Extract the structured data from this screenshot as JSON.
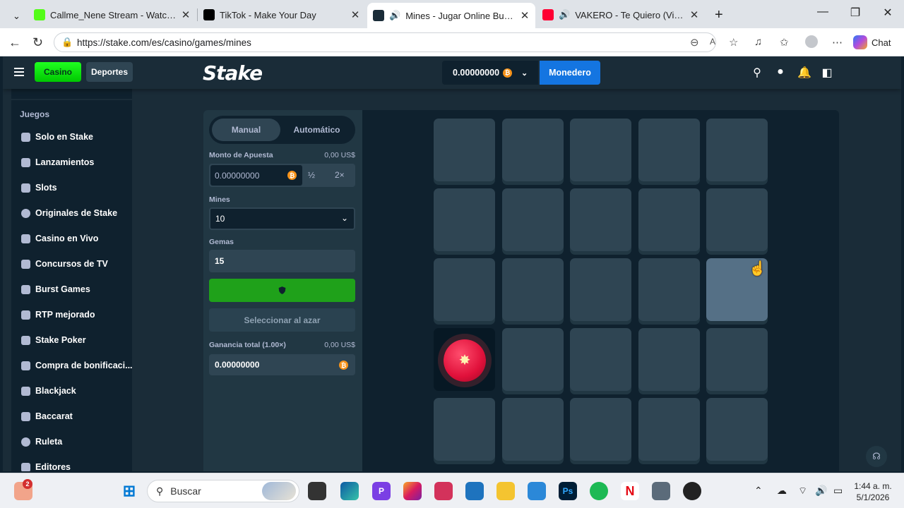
{
  "browser": {
    "tabs": [
      {
        "title": "Callme_Nene Stream - Watch Live",
        "icon": "kick-icon",
        "color": "#53fc18"
      },
      {
        "title": "TikTok - Make Your Day",
        "icon": "tiktok-icon",
        "color": "#000000"
      },
      {
        "title": "Mines - Jugar Online Buscami",
        "icon": "stake-icon",
        "color": "#1a2c38"
      },
      {
        "title": "VAKERO - Te Quiero (Video O",
        "icon": "youtube-icon",
        "color": "#ff0033"
      }
    ],
    "url": "https://stake.com/es/casino/games/mines",
    "chat_label": "Chat"
  },
  "header": {
    "casino_label": "Casino",
    "sports_label": "Deportes",
    "logo": "Stake",
    "balance": "0.00000000",
    "wallet_label": "Monedero",
    "coin_glyph": "₿"
  },
  "sidebar": {
    "section": "Juegos",
    "items": [
      {
        "label": "Solo en Stake",
        "icon": "stake-exclusive-icon"
      },
      {
        "label": "Lanzamientos",
        "icon": "rocket-icon"
      },
      {
        "label": "Slots",
        "icon": "slots-icon"
      },
      {
        "label": "Originales de Stake",
        "icon": "fire-icon"
      },
      {
        "label": "Casino en Vivo",
        "icon": "live-casino-icon"
      },
      {
        "label": "Concursos de TV",
        "icon": "tv-icon"
      },
      {
        "label": "Burst Games",
        "icon": "burst-icon"
      },
      {
        "label": "RTP mejorado",
        "icon": "rtp-icon"
      },
      {
        "label": "Stake Poker",
        "icon": "poker-icon"
      },
      {
        "label": "Compra de bonificaci...",
        "icon": "gift-icon"
      },
      {
        "label": "Blackjack",
        "icon": "blackjack-icon"
      },
      {
        "label": "Baccarat",
        "icon": "baccarat-icon"
      },
      {
        "label": "Ruleta",
        "icon": "roulette-icon"
      },
      {
        "label": "Editores",
        "icon": "publishers-icon"
      }
    ]
  },
  "game": {
    "mode_manual": "Manual",
    "mode_auto": "Automático",
    "bet_label": "Monto de Apuesta",
    "bet_usd": "0,00 US$",
    "bet_value": "0.00000000",
    "half_label": "½",
    "double_label": "2×",
    "mines_label": "Mines",
    "mines_value": "10",
    "gems_label": "Gemas",
    "gems_value": "15",
    "random_label": "Seleccionar al azar",
    "profit_label": "Ganancia total (1.00×)",
    "profit_usd": "0,00 US$",
    "profit_value": "0.00000000",
    "grid": {
      "rows": 5,
      "cols": 5,
      "mine_tile": [
        3,
        0
      ],
      "hover_tile": [
        2,
        4
      ]
    }
  },
  "taskbar": {
    "search_placeholder": "Buscar",
    "notification_badge": "2",
    "time": "1:44 a. m.",
    "date": "5/1/2026"
  },
  "colors": {
    "accent": "#1475e1",
    "play": "#1fa11a",
    "casino": "#00e701"
  }
}
